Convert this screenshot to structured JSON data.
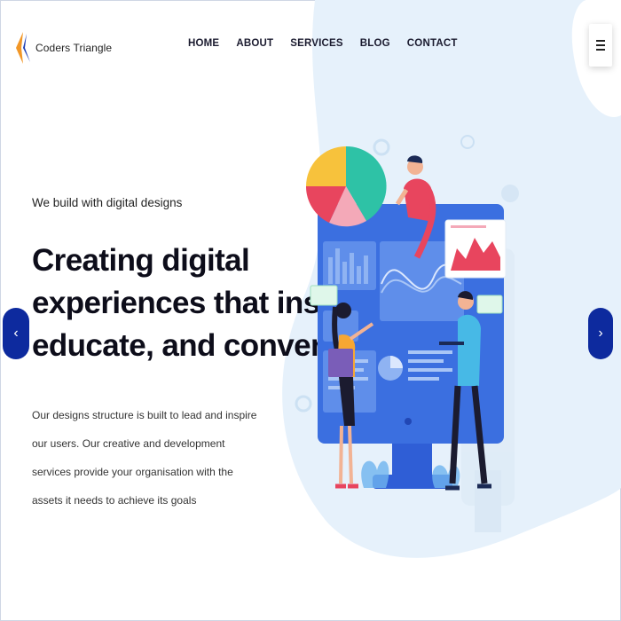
{
  "brand": {
    "name": "Coders Triangle",
    "colors": {
      "orange": "#f29727",
      "blue": "#1f3fb3"
    }
  },
  "nav": {
    "items": [
      "HOME",
      "ABOUT",
      "SERVICES",
      "BLOG",
      "CONTACT"
    ]
  },
  "menu_button": {
    "icon": "hamburger-icon"
  },
  "hero": {
    "tagline": "We build with digital designs",
    "headline": [
      "Creating digital",
      "experiences that inspire,",
      "educate, and convert"
    ],
    "description": "Our designs structure is built to lead and inspire our users. Our creative and development services provide your organisation with the assets it needs to achieve its goals"
  },
  "slider": {
    "prev_icon": "chevron-left-icon",
    "prev_glyph": "‹",
    "next_icon": "chevron-right-icon",
    "next_glyph": "›"
  },
  "theme": {
    "accent": "#0d2a9e",
    "blob": "#e6f1fb",
    "screen": "#3b6fe0"
  }
}
